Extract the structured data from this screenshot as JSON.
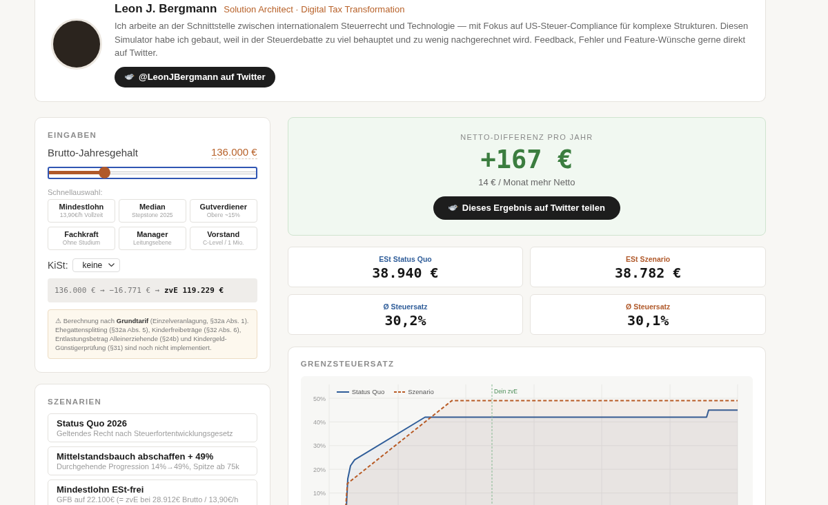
{
  "profile": {
    "name": "Leon J. Bergmann",
    "role": "Solution Architect · Digital Tax Transformation",
    "bio": "Ich arbeite an der Schnittstelle zwischen internationalem Steuerrecht und Technologie — mit Fokus auf US-Steuer-Compliance für komplexe Strukturen. Diesen Simulator habe ich gebaut, weil in der Steuerdebatte zu viel behauptet und zu wenig nachgerechnet wird. Feedback, Fehler und Feature-Wünsche gerne direkt auf Twitter.",
    "button": "@LeonJBergmann auf Twitter"
  },
  "inputs": {
    "title": "EINGABEN",
    "salary_label": "Brutto-Jahresgehalt",
    "salary_value": "136.000 €",
    "slider": {
      "level": 0.27
    },
    "quick_label": "Schnellauswahl:",
    "presets": [
      {
        "title": "Mindestlohn",
        "subtitle": "13,90€/h Vollzeit"
      },
      {
        "title": "Median",
        "subtitle": "Stepstone 2025"
      },
      {
        "title": "Gutverdiener",
        "subtitle": "Obere ~15%"
      },
      {
        "title": "Fachkraft",
        "subtitle": "Ohne Studium"
      },
      {
        "title": "Manager",
        "subtitle": "Leitungsebene"
      },
      {
        "title": "Vorstand",
        "subtitle": "C-Level / 1 Mio."
      }
    ],
    "church_tax": {
      "label": "KiSt:",
      "value": "keine"
    },
    "formula": "136.000 € → −16.771 € → **zvE 119.229 €**",
    "notice": "⚠ Berechnung nach **Grundtarif** (Einzelveranlagung, §32a Abs. 1). Ehegattensplitting (§32a Abs. 5), Kinderfreibeträge (§32 Abs. 6), Entlastungsbetrag Alleinerziehende (§24b) und Kindergeld-Günstigerprüfung (§31) sind noch nicht implementiert."
  },
  "scenarios": {
    "title": "SZENARIEN",
    "items": [
      {
        "title": "Status Quo 2026",
        "subtitle": "Geltendes Recht nach Steuerfortentwicklungsgesetz"
      },
      {
        "title": "Mittelstandsbauch abschaffen + 49%",
        "subtitle": "Durchgehende Progression 14%→49%, Spitze ab 75k"
      },
      {
        "title": "Mindestlohn ESt-frei",
        "subtitle": "GFB auf 22.100€ (= zvE bei 28.912€ Brutto / 13,90€/h"
      }
    ]
  },
  "result": {
    "title": "NETTO-DIFFERENZ PRO JAHR",
    "value": "+167 €",
    "subtitle": "14 € / Monat mehr Netto",
    "button": "Dieses Ergebnis auf Twitter teilen"
  },
  "stats": [
    {
      "label": "ESt Status Quo",
      "value": "38.940 €",
      "color": "#2f5d99"
    },
    {
      "label": "ESt Szenario",
      "value": "38.782 €",
      "color": "#b0592a"
    },
    {
      "label": "Ø Steuersatz",
      "value": "30,2%",
      "color": "#2f5d99"
    },
    {
      "label": "Ø Steuersatz",
      "value": "30,1%",
      "color": "#b0592a"
    }
  ],
  "chart": {
    "title": "GRENZSTEUERSATZ",
    "legend": [
      {
        "label": "Status Quo",
        "color": "#2f5d99",
        "kind": "solid"
      },
      {
        "label": "Szenario",
        "color": "#b85a24",
        "kind": "dashed"
      }
    ],
    "y_tick_labels": [
      "50%",
      "40%",
      "30%",
      "20%",
      "10%"
    ],
    "marker_label": "Dein zvE"
  }
}
